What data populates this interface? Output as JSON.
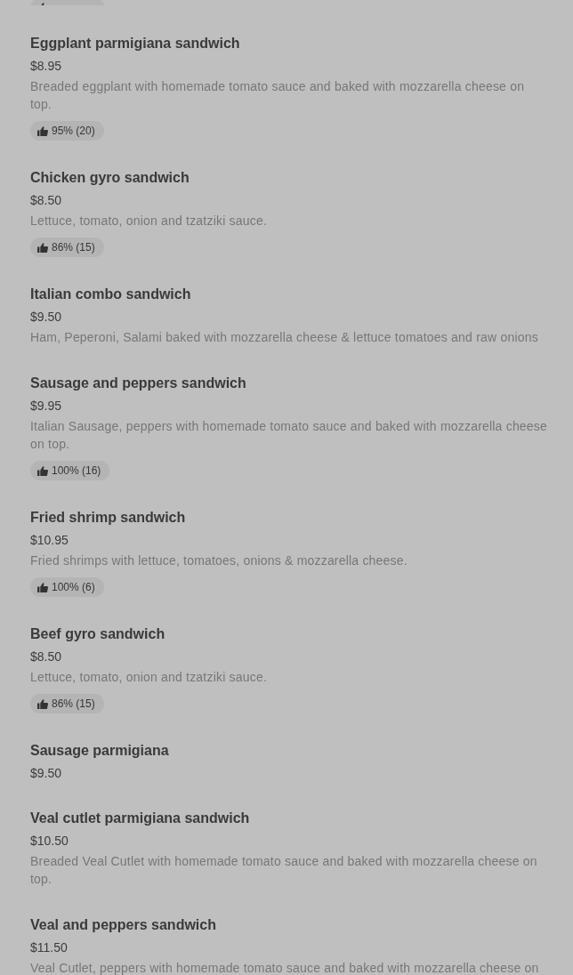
{
  "cut_off_badge": true,
  "items": [
    {
      "name": "Eggplant parmigiana sandwich",
      "price": "$8.95",
      "description": "Breaded eggplant with homemade tomato sauce and baked with mozzarella cheese on top.",
      "rating": "95% (20)"
    },
    {
      "name": "Chicken gyro sandwich",
      "price": "$8.50",
      "description": "Lettuce, tomato, onion and tzatziki sauce.",
      "rating": "86% (15)"
    },
    {
      "name": "Italian combo sandwich",
      "price": "$9.50",
      "description": "Ham, Peperoni, Salami baked with mozzarella cheese & lettuce tomatoes and raw onions"
    },
    {
      "name": "Sausage and peppers sandwich",
      "price": "$9.95",
      "description": "Italian Sausage, peppers with homemade tomato sauce and baked with mozzarella cheese on top.",
      "rating": "100% (16)"
    },
    {
      "name": "Fried shrimp sandwich",
      "price": "$10.95",
      "description": "Fried shrimps with lettuce, tomatoes, onions & mozzarella cheese.",
      "rating": "100% (6)"
    },
    {
      "name": "Beef gyro sandwich",
      "price": "$8.50",
      "description": "Lettuce, tomato, onion and tzatziki sauce.",
      "rating": "86% (15)"
    },
    {
      "name": "Sausage parmigiana",
      "price": "$9.50"
    },
    {
      "name": "Veal cutlet parmigiana sandwich",
      "price": "$10.50",
      "description": "Breaded Veal Cutlet with homemade tomato sauce and baked with mozzarella cheese on top."
    },
    {
      "name": "Veal and peppers sandwich",
      "price": "$11.50",
      "description": "Veal Cutlet, peppers with homemade tomato sauce and baked with mozzarella cheese on"
    }
  ]
}
